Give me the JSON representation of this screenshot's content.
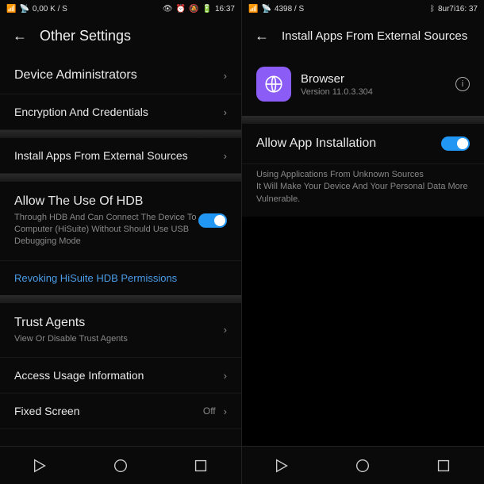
{
  "left": {
    "status": {
      "network": "0,00 K / S",
      "time": "16:37"
    },
    "header": {
      "title": "Other Settings"
    },
    "items": {
      "device_admins": "Device Administrators",
      "encryption": "Encryption And Credentials",
      "install_external": "Install Apps From External Sources",
      "hdb_title": "Allow The Use Of HDB",
      "hdb_sub": "Through HDB And Can Connect The Device To Computer (HiSuite) Without Should Use USB Debugging Mode",
      "revoke_hdb": "Revoking HiSuite HDB Permissions",
      "trust_agents": "Trust Agents",
      "trust_agents_sub": "View Or Disable Trust Agents",
      "access_usage": "Access Usage Information",
      "fixed_screen": "Fixed Screen",
      "fixed_screen_value": "Off"
    }
  },
  "right": {
    "status": {
      "network": "4398 / S",
      "time": "8ur7i16: 37"
    },
    "header": {
      "title": "Install Apps From External Sources"
    },
    "app": {
      "name": "Browser",
      "version": "Version 11.0.3.304"
    },
    "allow_label": "Allow App Installation",
    "warning_l1": "Using Applications From Unknown Sources",
    "warning_l2": "It Will Make Your Device And Your Personal Data More Vulnerable."
  }
}
